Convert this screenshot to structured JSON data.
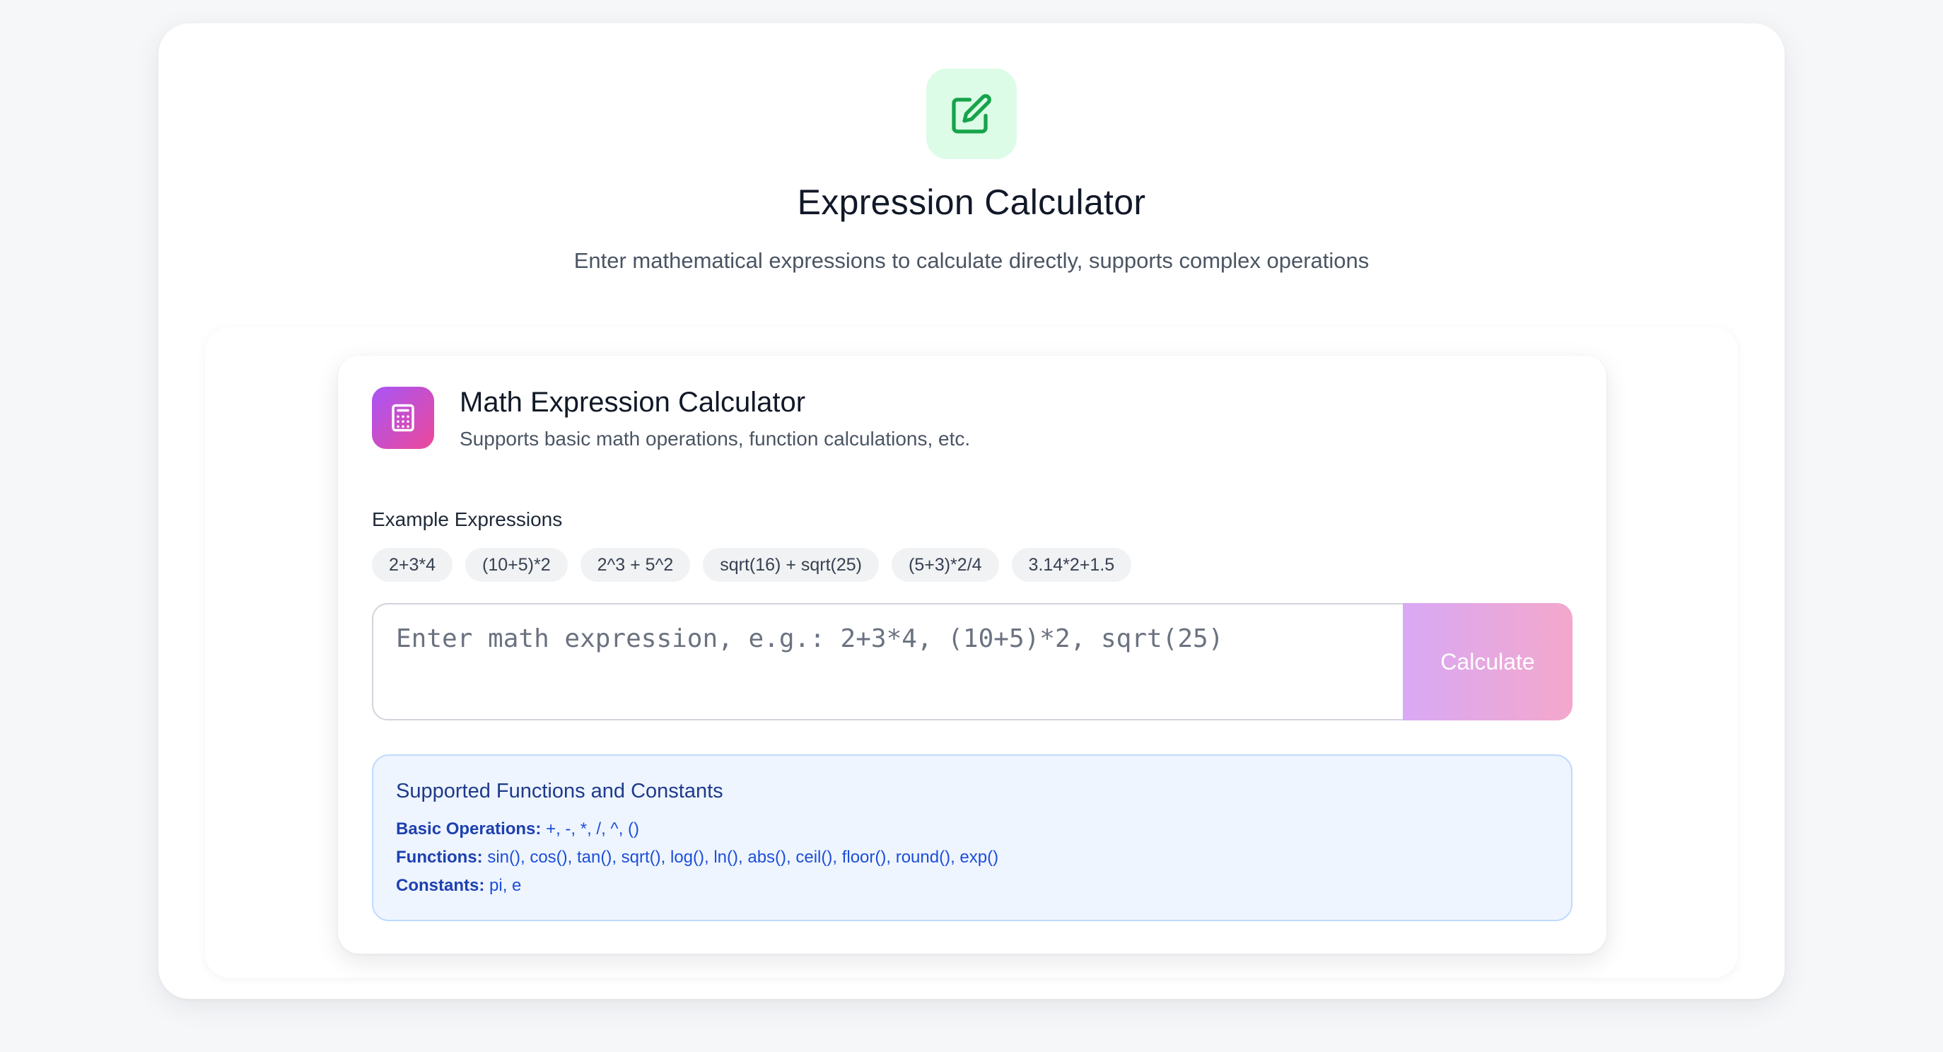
{
  "header": {
    "title": "Expression Calculator",
    "subtitle": "Enter mathematical expressions to calculate directly, supports complex operations",
    "icon": "edit-icon"
  },
  "calculator": {
    "title": "Math Expression Calculator",
    "subtitle": "Supports basic math operations, function calculations, etc.",
    "icon": "calculator-icon",
    "examples_label": "Example Expressions",
    "examples": [
      "2+3*4",
      "(10+5)*2",
      "2^3 + 5^2",
      "sqrt(16) + sqrt(25)",
      "(5+3)*2/4",
      "3.14*2+1.5"
    ],
    "input_value": "",
    "input_placeholder": "Enter math expression, e.g.: 2+3*4, (10+5)*2, sqrt(25)",
    "button_label": "Calculate"
  },
  "info": {
    "title": "Supported Functions and Constants",
    "basic_label": "Basic Operations:",
    "basic_value": " +, -, *, /, ^, ()",
    "functions_label": "Functions:",
    "functions_value": " sin(), cos(), tan(), sqrt(), log(), ln(), abs(), ceil(), floor(), round(), exp()",
    "constants_label": "Constants:",
    "constants_value": " pi, e"
  },
  "colors": {
    "hero_icon_bg": "#dcfce7",
    "hero_icon_fg": "#16a34a",
    "accent_purple": "#a855f7",
    "accent_pink": "#ec4899",
    "info_bg": "#eef5ff",
    "info_text": "#1d4ed8"
  }
}
